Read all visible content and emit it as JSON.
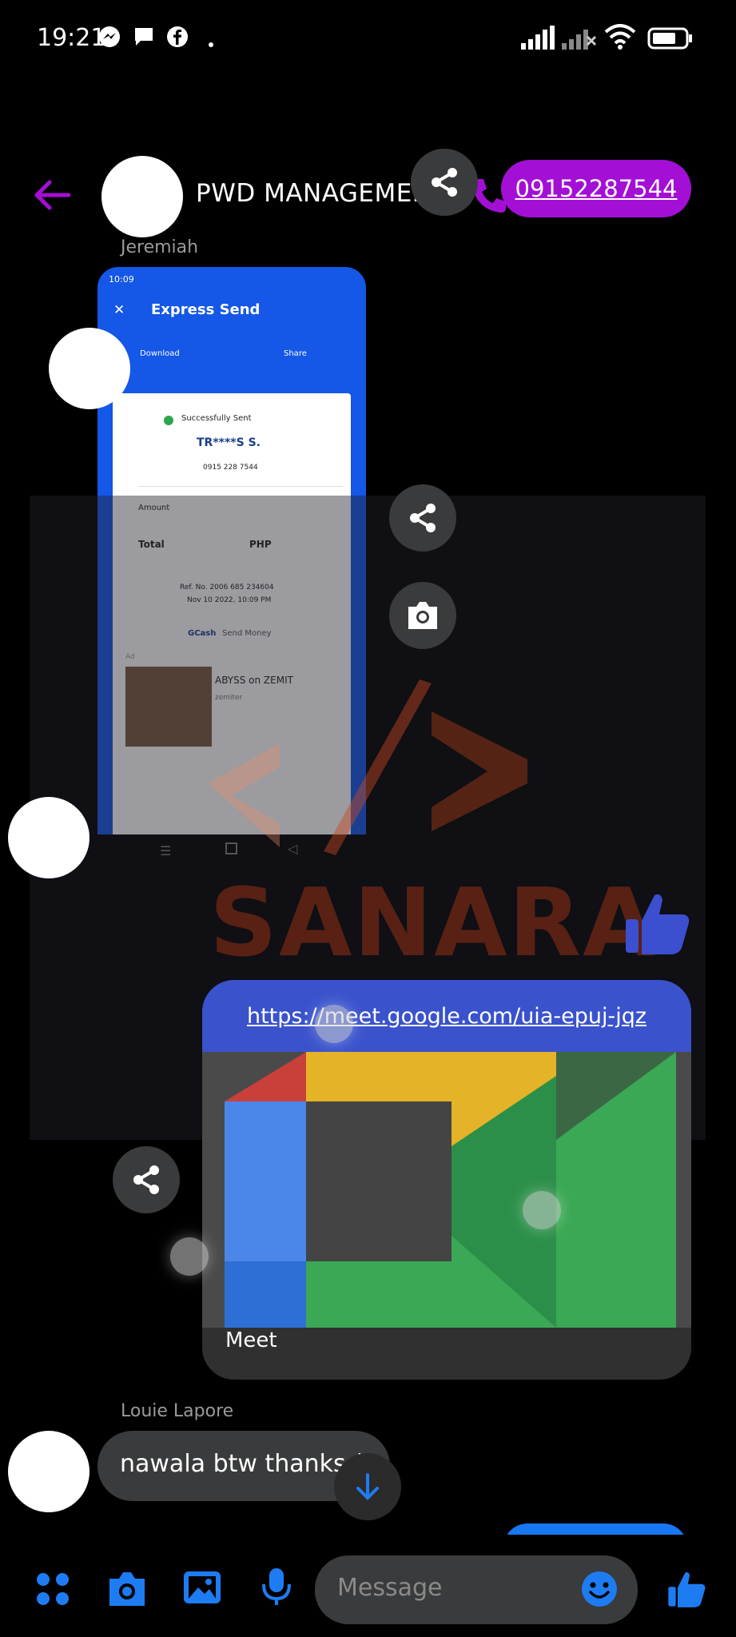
{
  "status_bar": {
    "time": "19:21",
    "battery_label": "77"
  },
  "header": {
    "title": "PWD MANAGEMEN...",
    "accent": "#a40fd6"
  },
  "messages": {
    "phone_number": "09152287544",
    "sender_1": "Jeremiah",
    "sender_2": "Louie Lapore",
    "last_message": "nawala btw thanks ("
  },
  "screenshot": {
    "time": "10:09",
    "title": "Express Send",
    "download": "Download",
    "share": "Share",
    "success": "Successfully Sent",
    "recipient": "TR****S S.",
    "number": "0915 228 7544",
    "amount_label": "Amount",
    "total_label": "Total",
    "currency": "PHP",
    "ref": "Ref. No. 2006 685 234604",
    "date": "Nov 10 2022, 10:09 PM",
    "brand": "GCash",
    "brand_suffix": "Send Money",
    "ad_label": "Ad",
    "ad_title": "ABYSS on ZEMIT",
    "ad_sub": "zemiter"
  },
  "watermark": {
    "text": "SANARA"
  },
  "meet_card": {
    "link": "https://meet.google.com/uia-epuj-jqz",
    "caption": "Meet"
  },
  "composer": {
    "placeholder": "Message"
  }
}
